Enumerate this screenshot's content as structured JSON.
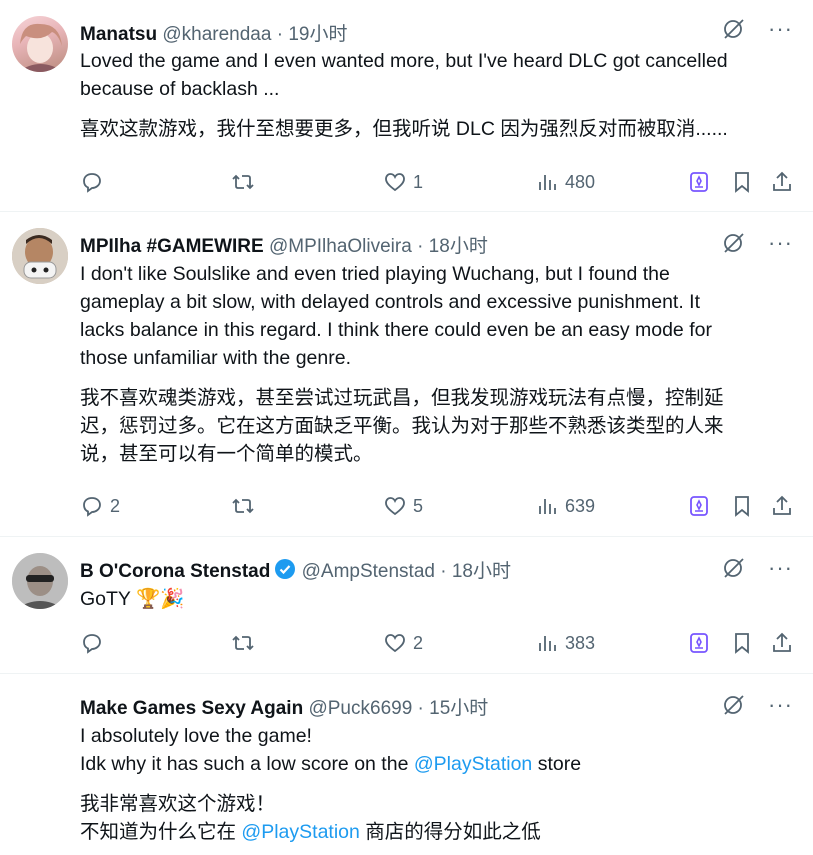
{
  "tweets": [
    {
      "name": "Manatsu",
      "handle": "@kharendaa",
      "time": "· 19小时",
      "text_en_1": "Loved the game and I even wanted more, but I've heard DLC got cancelled",
      "text_en_2": "because of backlash ...",
      "text_zh": "喜欢这款游戏，我什至想要更多，但我听说 DLC 因为强烈反对而被取消......",
      "replies": "",
      "likes": "1",
      "views": "480"
    },
    {
      "name": "MPIlha #GAMEWIRE",
      "handle": "@MPIlhaOliveira",
      "time": "· 18小时",
      "text_en_1": "I don't like Soulslike and even tried playing Wuchang, but I found the",
      "text_en_2": "gameplay a bit slow, with delayed controls and excessive punishment. It",
      "text_en_3": "lacks balance in this regard. I think there could even be an easy mode for",
      "text_en_4": "those unfamiliar with the genre.",
      "text_zh_1": "我不喜欢魂类游戏，甚至尝试过玩武昌，但我发现游戏玩法有点慢，控制延",
      "text_zh_2": "迟，惩罚过多。它在这方面缺乏平衡。我认为对于那些不熟悉该类型的人来",
      "text_zh_3": "说，甚至可以有一个简单的模式。",
      "replies": "2",
      "likes": "5",
      "views": "639"
    },
    {
      "name": "B O'Corona Stenstad",
      "handle": "@AmpStenstad",
      "time": "· 18小时",
      "text": "GoTY",
      "emoji_1": "🏆",
      "emoji_2": "🎉",
      "replies": "",
      "likes": "2",
      "views": "383"
    },
    {
      "name": "Make Games Sexy Again",
      "handle": "@Puck6699",
      "time": "· 15小时",
      "text_en_1": "I absolutely love the game!",
      "text_en_2_pre": "Idk why it has such a low score on the ",
      "mention": "@PlayStation",
      "text_en_2_post": " store",
      "text_zh_1": "我非常喜欢这个游戏！",
      "text_zh_2_pre": "不知道为什么它在 ",
      "text_zh_2_post": " 商店的得分如此之低"
    }
  ],
  "icons": {
    "more": "more-icon",
    "grok": "grok-icon",
    "reply": "reply-icon",
    "retweet": "retweet-icon",
    "like": "like-icon",
    "views": "views-icon",
    "bookmark": "bookmark-icon",
    "share": "share-icon"
  },
  "colors": {
    "link": "#1d9bf0",
    "secondary": "#536471",
    "grok": "#7856ff",
    "verified": "#1d9bf0"
  }
}
